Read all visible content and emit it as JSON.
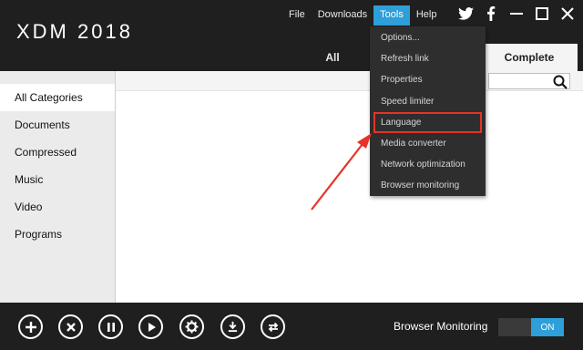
{
  "app": {
    "logo": "XDM 2018"
  },
  "menu": [
    {
      "label": "File",
      "active": false
    },
    {
      "label": "Downloads",
      "active": false
    },
    {
      "label": "Tools",
      "active": true
    },
    {
      "label": "Help",
      "active": false
    }
  ],
  "tabs": {
    "all": "All",
    "complete": "Complete"
  },
  "sidebar": {
    "items": [
      {
        "label": "All Categories",
        "selected": true
      },
      {
        "label": "Documents",
        "selected": false
      },
      {
        "label": "Compressed",
        "selected": false
      },
      {
        "label": "Music",
        "selected": false
      },
      {
        "label": "Video",
        "selected": false
      },
      {
        "label": "Programs",
        "selected": false
      }
    ]
  },
  "tools_menu": {
    "items": [
      {
        "label": "Options..."
      },
      {
        "label": "Refresh link"
      },
      {
        "label": "Properties"
      },
      {
        "label": "Speed limiter"
      },
      {
        "label": "Language",
        "highlighted": true
      },
      {
        "label": "Media converter"
      },
      {
        "label": "Network optimization"
      },
      {
        "label": "Browser monitoring"
      }
    ]
  },
  "bottom": {
    "buttons": [
      "add-icon",
      "close-icon",
      "pause-icon",
      "play-icon",
      "settings-icon",
      "download-icon",
      "sync-icon"
    ],
    "browser_monitoring_label": "Browser Monitoring",
    "toggle_label": "ON"
  },
  "colors": {
    "accent": "#2e9fd8",
    "highlight_box": "#e5332a",
    "dark_bg": "#1f1f1f"
  }
}
